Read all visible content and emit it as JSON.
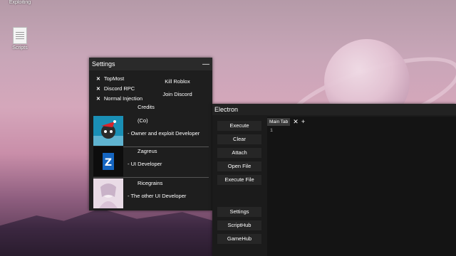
{
  "desktop": {
    "icons": [
      {
        "label": "Exploiting"
      },
      {
        "label": "Scripts"
      }
    ]
  },
  "settings": {
    "title": "Settings",
    "minimize_symbol": "—",
    "options": [
      {
        "mark": "✕",
        "label": "TopMost"
      },
      {
        "mark": "✕",
        "label": "Discord RPC"
      },
      {
        "mark": "✕",
        "label": "Normal Injection"
      }
    ],
    "kill_roblox_label": "Kill Roblox",
    "join_discord_label": "Join Discord",
    "credits_title": "Credits",
    "credits": [
      {
        "name": "(Co)",
        "role": "- Owner and exploit Developer"
      },
      {
        "name": "Zagreus",
        "role": "- UI Developer"
      },
      {
        "name": "Ricegrains",
        "role": "- The other UI Developer"
      }
    ]
  },
  "electron": {
    "title": "Electron",
    "buttons": {
      "execute": "Execute",
      "clear": "Clear",
      "attach": "Attach",
      "open_file": "Open File",
      "execute_file": "Execute File",
      "settings": "Settings",
      "scripthub": "ScriptHub",
      "gamehub": "GameHub"
    },
    "tab_label": "Main Tab",
    "close_tab_symbol": "✕",
    "add_tab_symbol": "+",
    "line_number": "1"
  }
}
